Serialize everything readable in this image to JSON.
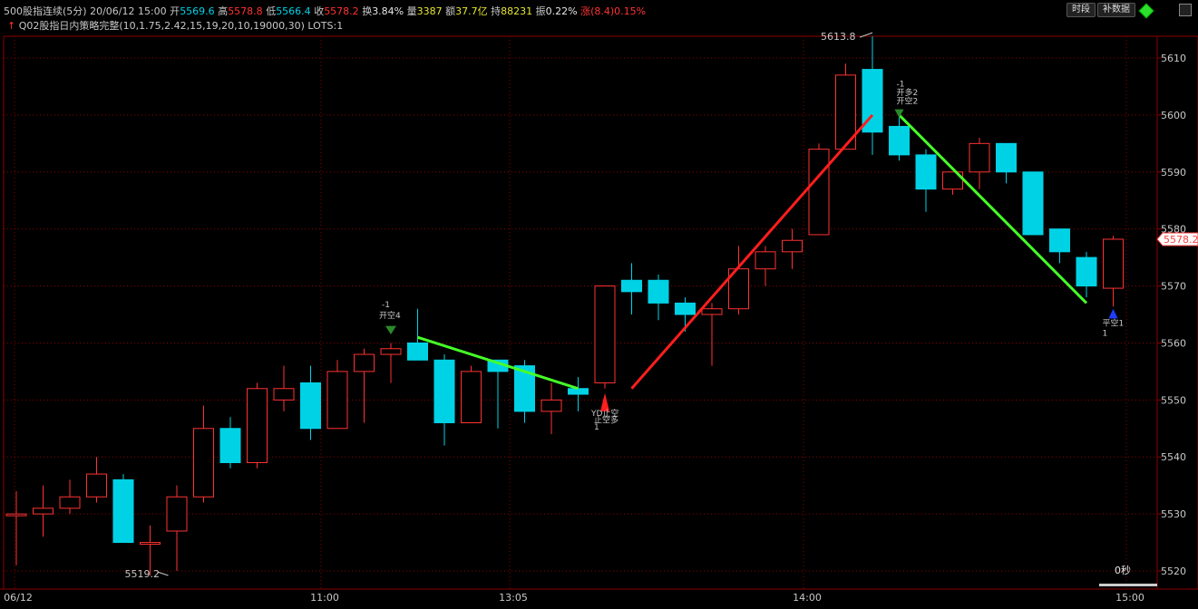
{
  "header": {
    "symbol": "500股指连续(5分)",
    "datetime": "20/06/12 15:00",
    "open_label": "开",
    "open": "5569.6",
    "high_label": "高",
    "high": "5578.8",
    "low_label": "低",
    "low": "5566.4",
    "close_label": "收",
    "close": "5578.2",
    "turnover_label": "换",
    "turnover": "3.84%",
    "volume_label": "量",
    "volume": "3387",
    "amount_label": "额",
    "amount": "37.7亿",
    "openint_label": "持",
    "openint": "88231",
    "amp_label": "振",
    "amp": "0.22%",
    "change_label": "涨",
    "change": "(8.4)0.15%",
    "strategy": "Q02股指日内策略完整(10,1.75,2.42,15,19,20,10,19000,30)",
    "lots": "LOTS:1"
  },
  "toolbar": {
    "time_button": "时段",
    "supplement_button": "补数据"
  },
  "colors": {
    "up": "#ff3232",
    "down": "#00d2e6",
    "grid": "#8c0000",
    "green_line": "#46ff28",
    "red_line": "#ff1e1e",
    "text": "#c8c8c8",
    "price_tag": "#ff4040"
  },
  "chart_data": {
    "type": "candlestick",
    "interval": "5分",
    "y_ticks": [
      5520,
      5530,
      5540,
      5550,
      5560,
      5570,
      5580,
      5590,
      5600,
      5610
    ],
    "x_labels": [
      "06/12",
      "11:00",
      "13:05",
      "14:00",
      "15:00"
    ],
    "candles": [
      {
        "o": 5530,
        "h": 5534,
        "l": 5521,
        "c": 5530
      },
      {
        "o": 5530,
        "h": 5535,
        "l": 5526,
        "c": 5531
      },
      {
        "o": 5531,
        "h": 5536,
        "l": 5530,
        "c": 5533
      },
      {
        "o": 5533,
        "h": 5540,
        "l": 5532,
        "c": 5537
      },
      {
        "o": 5536,
        "h": 5537,
        "l": 5525,
        "c": 5525
      },
      {
        "o": 5525,
        "h": 5528,
        "l": 5519.2,
        "c": 5525
      },
      {
        "o": 5527,
        "h": 5535,
        "l": 5520,
        "c": 5533
      },
      {
        "o": 5533,
        "h": 5549,
        "l": 5532,
        "c": 5545
      },
      {
        "o": 5545,
        "h": 5547,
        "l": 5538,
        "c": 5539
      },
      {
        "o": 5539,
        "h": 5553,
        "l": 5538,
        "c": 5552
      },
      {
        "o": 5550,
        "h": 5556,
        "l": 5548,
        "c": 5552
      },
      {
        "o": 5553,
        "h": 5556,
        "l": 5543,
        "c": 5545
      },
      {
        "o": 5545,
        "h": 5557,
        "l": 5545,
        "c": 5555
      },
      {
        "o": 5555,
        "h": 5559,
        "l": 5546,
        "c": 5558
      },
      {
        "o": 5558,
        "h": 5560,
        "l": 5553,
        "c": 5559
      },
      {
        "o": 5560,
        "h": 5566,
        "l": 5557,
        "c": 5557
      },
      {
        "o": 5557,
        "h": 5558,
        "l": 5542,
        "c": 5546
      },
      {
        "o": 5546,
        "h": 5556,
        "l": 5546,
        "c": 5555
      },
      {
        "o": 5557,
        "h": 5557,
        "l": 5545,
        "c": 5555
      },
      {
        "o": 5556,
        "h": 5557,
        "l": 5546,
        "c": 5548
      },
      {
        "o": 5548,
        "h": 5553,
        "l": 5544,
        "c": 5550
      },
      {
        "o": 5552,
        "h": 5554,
        "l": 5548,
        "c": 5551
      },
      {
        "o": 5553,
        "h": 5570,
        "l": 5552,
        "c": 5570
      },
      {
        "o": 5571,
        "h": 5574,
        "l": 5565,
        "c": 5569
      },
      {
        "o": 5571,
        "h": 5572,
        "l": 5564,
        "c": 5567
      },
      {
        "o": 5567,
        "h": 5568,
        "l": 5562,
        "c": 5565
      },
      {
        "o": 5565,
        "h": 5567,
        "l": 5556,
        "c": 5566
      },
      {
        "o": 5566,
        "h": 5577,
        "l": 5565,
        "c": 5573
      },
      {
        "o": 5573,
        "h": 5577,
        "l": 5570,
        "c": 5576
      },
      {
        "o": 5576,
        "h": 5580,
        "l": 5573,
        "c": 5578
      },
      {
        "o": 5579,
        "h": 5595,
        "l": 5579,
        "c": 5594
      },
      {
        "o": 5594,
        "h": 5609,
        "l": 5594,
        "c": 5607
      },
      {
        "o": 5608,
        "h": 5613.8,
        "l": 5593,
        "c": 5597
      },
      {
        "o": 5598,
        "h": 5600,
        "l": 5592,
        "c": 5593
      },
      {
        "o": 5593,
        "h": 5594,
        "l": 5583,
        "c": 5587
      },
      {
        "o": 5587,
        "h": 5589,
        "l": 5586,
        "c": 5590
      },
      {
        "o": 5590,
        "h": 5596,
        "l": 5587,
        "c": 5595
      },
      {
        "o": 5595,
        "h": 5595,
        "l": 5588,
        "c": 5590
      },
      {
        "o": 5590,
        "h": 5590,
        "l": 5579,
        "c": 5579
      },
      {
        "o": 5580,
        "h": 5580,
        "l": 5574,
        "c": 5576
      },
      {
        "o": 5575,
        "h": 5576,
        "l": 5568,
        "c": 5570
      },
      {
        "o": 5569.6,
        "h": 5578.8,
        "l": 5566.4,
        "c": 5578.2
      }
    ],
    "trend_lines": [
      {
        "color": "green",
        "from": {
          "i": 15,
          "v": 5561
        },
        "to": {
          "i": 21,
          "v": 5552
        }
      },
      {
        "color": "red",
        "from": {
          "i": 23,
          "v": 5552
        },
        "to": {
          "i": 32,
          "v": 5600
        }
      },
      {
        "color": "green",
        "from": {
          "i": 33,
          "v": 5600
        },
        "to": {
          "i": 40,
          "v": 5567
        }
      }
    ],
    "annotations": {
      "high_label": "5613.8",
      "low_label": "5519.2",
      "last_price": "5578.2",
      "signal1_top": "-1",
      "signal1_text": "开空4",
      "signal2_text": "YD止空",
      "signal2_sub": "止空多",
      "signal2_num": "1",
      "signal3_top": "-1",
      "signal3_text": "开多2",
      "signal3_sub": "开空2",
      "signal4_text": "平空1",
      "signal4_num": "1",
      "countdown": "0秒"
    }
  }
}
